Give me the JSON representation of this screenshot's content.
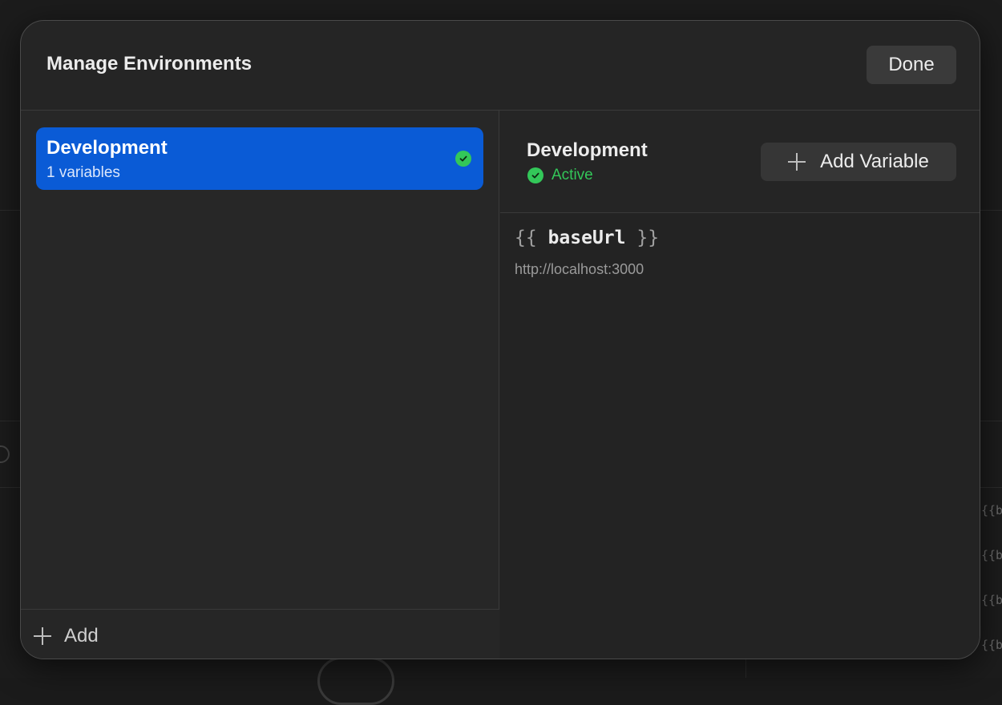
{
  "modal": {
    "title": "Manage Environments",
    "done_label": "Done"
  },
  "environments": [
    {
      "name": "Development",
      "count_label": "1 variables",
      "active": true,
      "selected": true
    }
  ],
  "left_footer": {
    "add_label": "Add"
  },
  "detail": {
    "title": "Development",
    "status": "Active",
    "add_variable_label": "Add Variable",
    "variables": [
      {
        "open": "{{",
        "key": "baseUrl",
        "close": "}}",
        "value": "http://localhost:3000"
      }
    ]
  },
  "background": {
    "token_fragment": "{{b"
  },
  "colors": {
    "accent": "#0a5bd6",
    "active_green": "#33c759",
    "modal_bg": "#252525"
  },
  "icons": [
    "checkmark-circle-icon",
    "plus-icon"
  ]
}
